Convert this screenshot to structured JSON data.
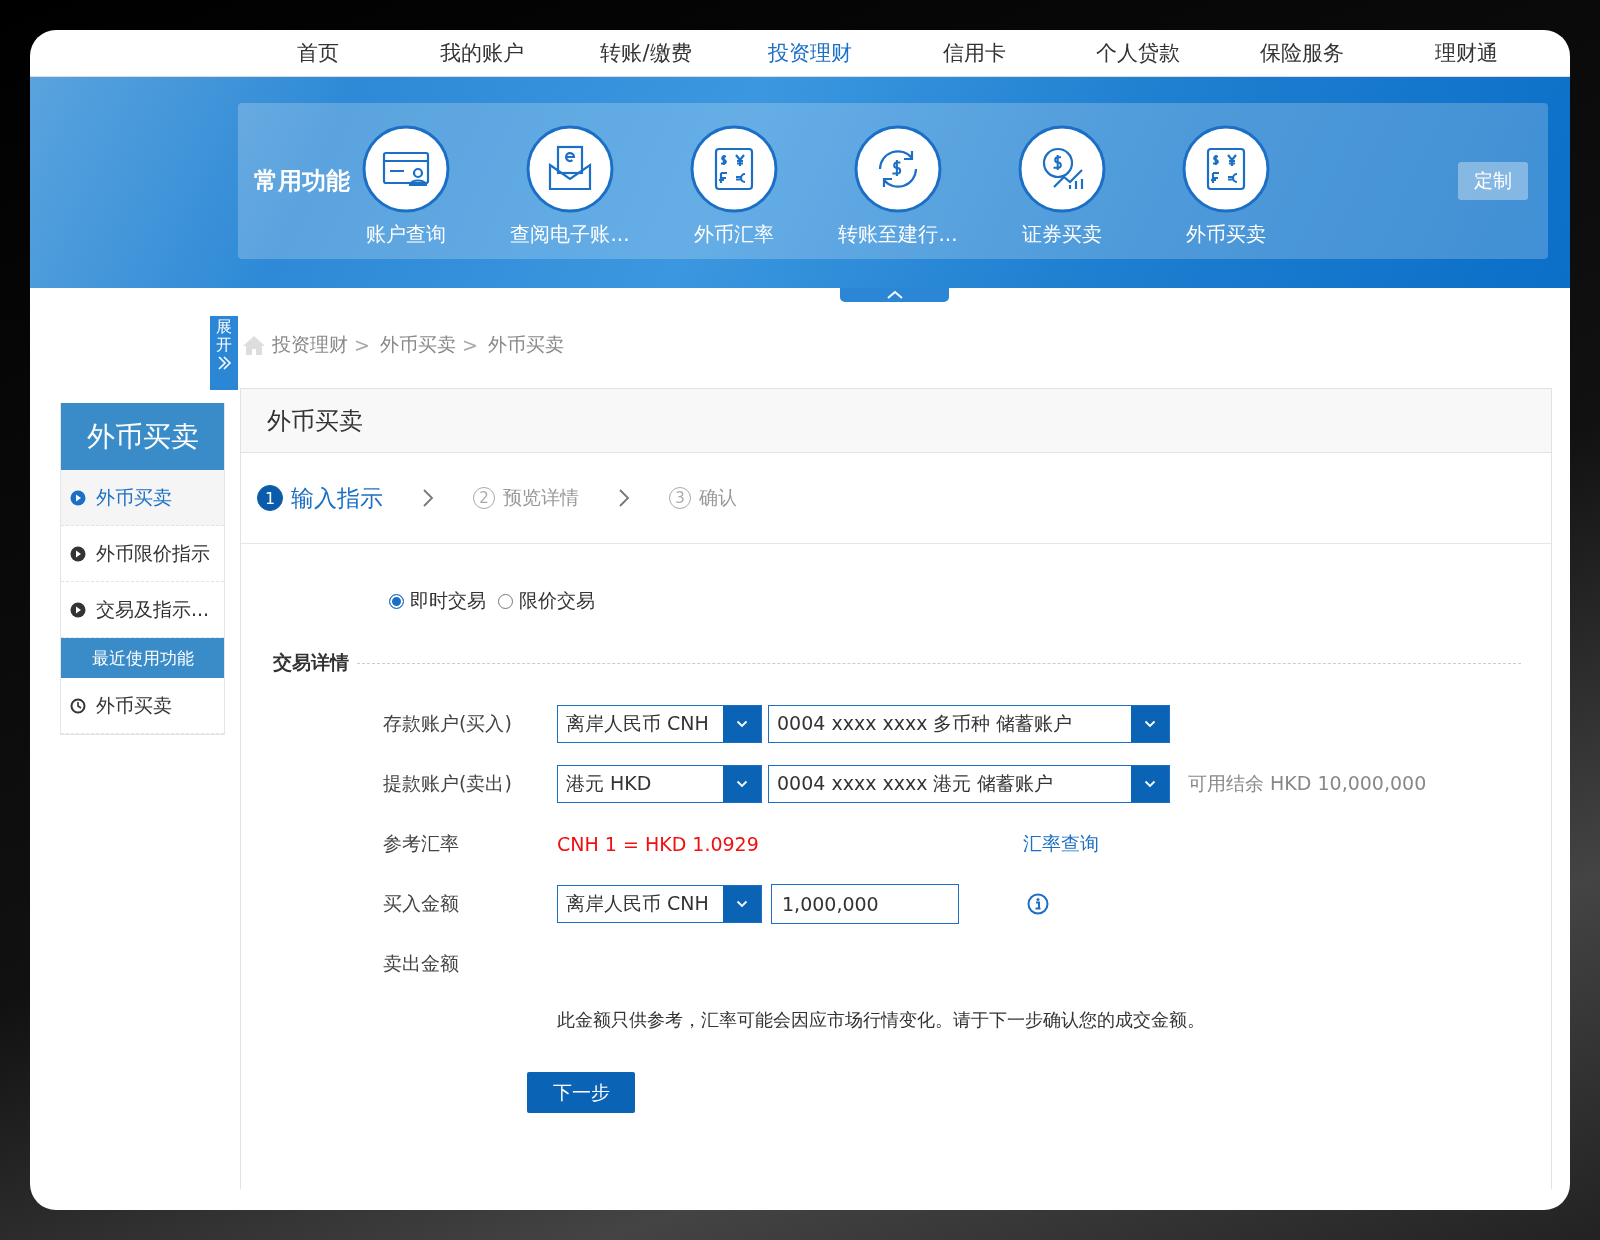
{
  "nav": [
    {
      "label": "首页",
      "selected": false
    },
    {
      "label": "我的账户",
      "selected": false
    },
    {
      "label": "转账/缴费",
      "selected": false
    },
    {
      "label": "投资理财",
      "selected": true
    },
    {
      "label": "信用卡",
      "selected": false
    },
    {
      "label": "个人贷款",
      "selected": false
    },
    {
      "label": "保险服务",
      "selected": false
    },
    {
      "label": "理财通",
      "selected": false
    }
  ],
  "quick_panel": {
    "title": "常用功能",
    "customize_button": "定制",
    "items": [
      {
        "label": "账户查询",
        "kind": "card"
      },
      {
        "label": "查阅电子账...",
        "kind": "envelope"
      },
      {
        "label": "外币汇率",
        "kind": "currency"
      },
      {
        "label": "转账至建行...",
        "kind": "exchange"
      },
      {
        "label": "证券买卖",
        "kind": "chart"
      },
      {
        "label": "外币买卖",
        "kind": "currency"
      }
    ]
  },
  "expand_tab": {
    "label": "展开"
  },
  "breadcrumb": {
    "separator": ">",
    "items": [
      "投资理财",
      "外币买卖",
      "外币买卖"
    ]
  },
  "sidebar": {
    "title": "外币买卖",
    "items": [
      {
        "label": "外币买卖",
        "selected": true
      },
      {
        "label": "外币限价指示",
        "selected": false
      },
      {
        "label": "交易及指示...",
        "selected": false
      }
    ],
    "recent_title": "最近使用功能",
    "recent_items": [
      {
        "label": "外币买卖"
      }
    ]
  },
  "page_title": "外币买卖",
  "steps": [
    {
      "number": "1",
      "label": "输入指示",
      "selected": true
    },
    {
      "number": "2",
      "label": "预览详情",
      "selected": false
    },
    {
      "number": "3",
      "label": "确认",
      "selected": false
    }
  ],
  "trade_type": [
    {
      "label": "即时交易",
      "selected": true
    },
    {
      "label": "限价交易",
      "selected": false
    }
  ],
  "section_title": "交易详情",
  "deposit_account": {
    "label": "存款账户(买入)",
    "currency": "离岸人民币 CNH",
    "account": "0004 xxxx xxxx 多币种 储蓄账户"
  },
  "withdraw_account": {
    "label": "提款账户(卖出)",
    "currency": "港元 HKD",
    "account": "0004 xxxx xxxx 港元 储蓄账户",
    "balance": "可用结余 HKD 10,000,000"
  },
  "rate": {
    "label": "参考汇率",
    "value": "CNH 1 = HKD 1.0929",
    "link": "汇率查询"
  },
  "buy_amount": {
    "label": "买入金额",
    "currency": "离岸人民币 CNH",
    "value": "1,000,000"
  },
  "sell_amount": {
    "label": "卖出金额"
  },
  "note": "此金额只供参考，汇率可能会因应市场行情变化。请于下一步确认您的成交金额。",
  "next_button": "下一步"
}
